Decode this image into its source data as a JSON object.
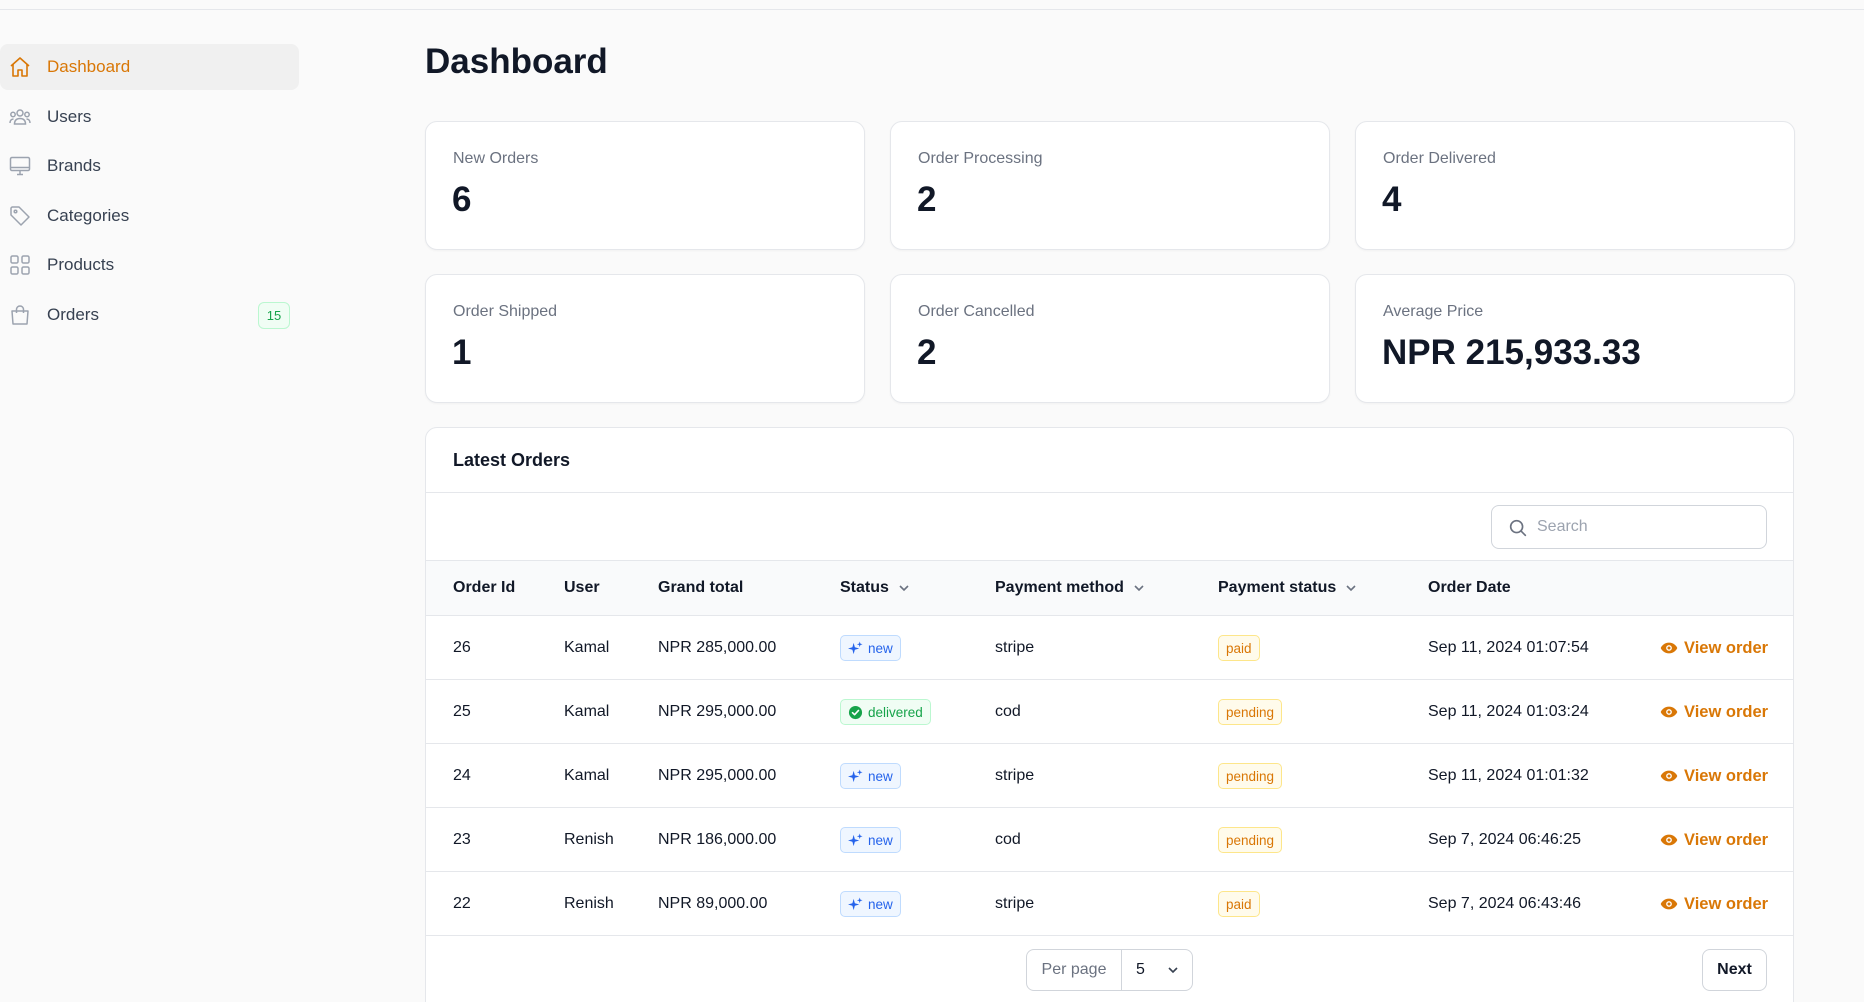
{
  "sidebar": {
    "items": [
      {
        "label": "Dashboard",
        "icon": "home-icon",
        "active": true
      },
      {
        "label": "Users",
        "icon": "users-icon"
      },
      {
        "label": "Brands",
        "icon": "monitor-icon"
      },
      {
        "label": "Categories",
        "icon": "tag-icon"
      },
      {
        "label": "Products",
        "icon": "grid-icon"
      },
      {
        "label": "Orders",
        "icon": "shopping-bag-icon",
        "badge": "15"
      }
    ]
  },
  "page": {
    "title": "Dashboard"
  },
  "stats": [
    {
      "label": "New Orders",
      "value": "6"
    },
    {
      "label": "Order Processing",
      "value": "2"
    },
    {
      "label": "Order Delivered",
      "value": "4"
    },
    {
      "label": "Order Shipped",
      "value": "1"
    },
    {
      "label": "Order Cancelled",
      "value": "2"
    },
    {
      "label": "Average Price",
      "value": "NPR 215,933.33"
    }
  ],
  "orders": {
    "title": "Latest Orders",
    "search_placeholder": "Search",
    "columns": [
      "Order Id",
      "User",
      "Grand total",
      "Status",
      "Payment method",
      "Payment status",
      "Order Date"
    ],
    "rows": [
      {
        "id": "26",
        "user": "Kamal",
        "total": "NPR 285,000.00",
        "status": "new",
        "method": "stripe",
        "payment_status": "paid",
        "date": "Sep 11, 2024 01:07:54",
        "action": "View order"
      },
      {
        "id": "25",
        "user": "Kamal",
        "total": "NPR 295,000.00",
        "status": "delivered",
        "method": "cod",
        "payment_status": "pending",
        "date": "Sep 11, 2024 01:03:24",
        "action": "View order"
      },
      {
        "id": "24",
        "user": "Kamal",
        "total": "NPR 295,000.00",
        "status": "new",
        "method": "stripe",
        "payment_status": "pending",
        "date": "Sep 11, 2024 01:01:32",
        "action": "View order"
      },
      {
        "id": "23",
        "user": "Renish",
        "total": "NPR 186,000.00",
        "status": "new",
        "method": "cod",
        "payment_status": "pending",
        "date": "Sep 7, 2024 06:46:25",
        "action": "View order"
      },
      {
        "id": "22",
        "user": "Renish",
        "total": "NPR 89,000.00",
        "status": "new",
        "method": "stripe",
        "payment_status": "paid",
        "date": "Sep 7, 2024 06:43:46",
        "action": "View order"
      }
    ],
    "pagination": {
      "per_page_label": "Per page",
      "per_page_value": "5",
      "next_label": "Next"
    }
  },
  "colors": {
    "accent": "#d97706",
    "new": "#2563eb",
    "delivered": "#16a34a",
    "warning": "#d97706"
  }
}
